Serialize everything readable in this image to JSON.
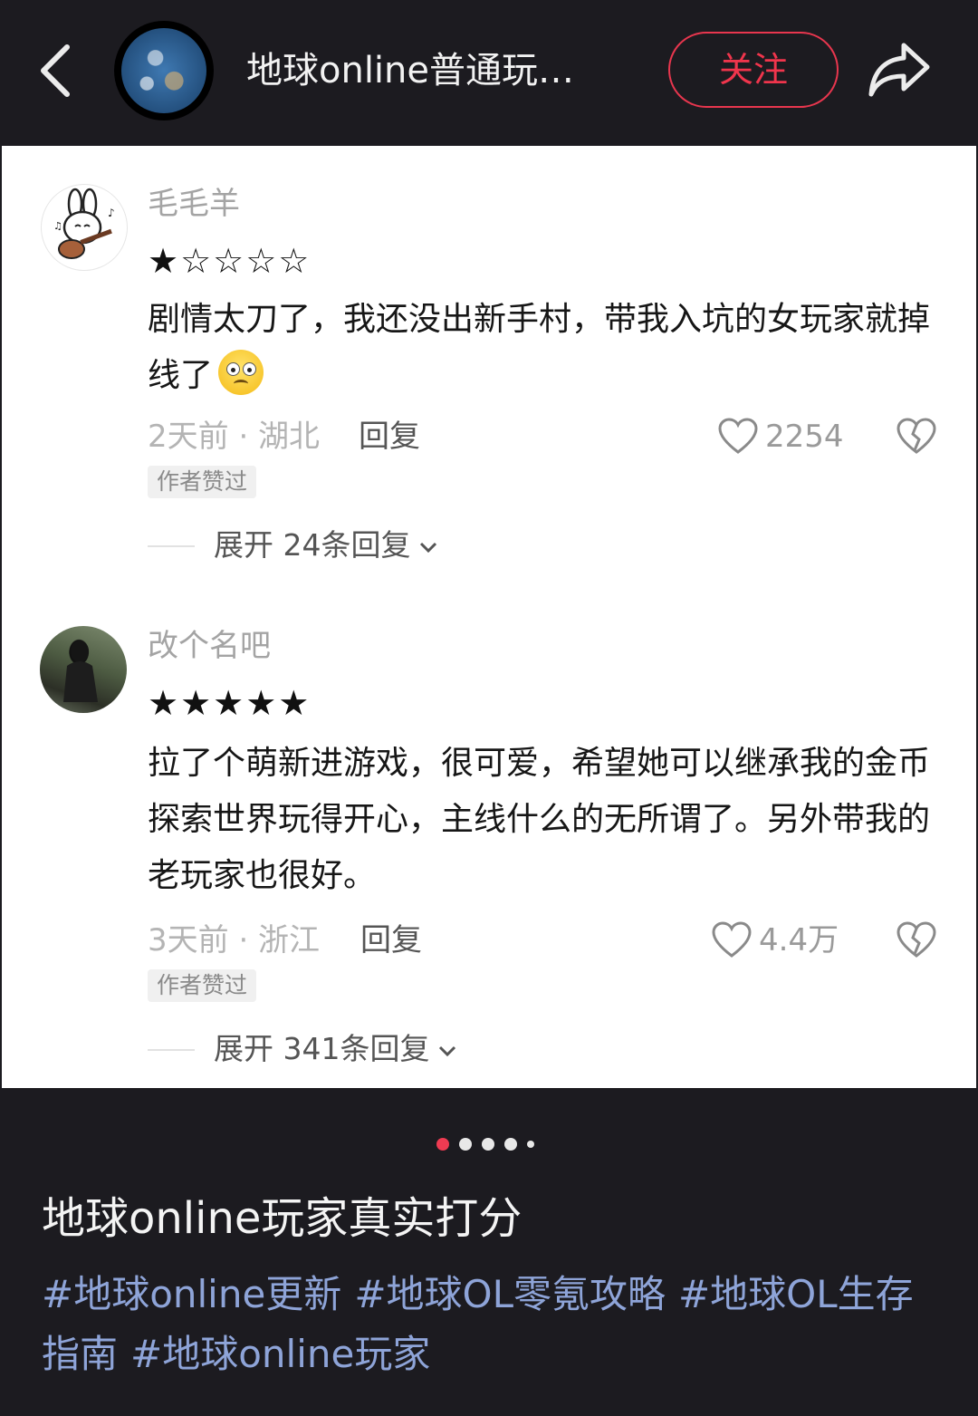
{
  "header": {
    "title": "地球online普通玩…",
    "follow_label": "关注",
    "accent_color": "#f0354c",
    "icons": [
      "back-arrow-icon",
      "earth-avatar",
      "share-icon"
    ]
  },
  "comments": [
    {
      "username": "毛毛羊",
      "stars": "★☆☆☆☆",
      "rating": 1,
      "text": "剧情太刀了，我还没出新手村，带我入坑的女玩家就掉线了",
      "emoji": "eyes-emoji",
      "time_location": "2天前 · 湖北",
      "reply_label": "回复",
      "likes": "2254",
      "badge": "作者赞过",
      "expand_label": "展开 24条回复"
    },
    {
      "username": "改个名吧",
      "stars": "★★★★★",
      "rating": 5,
      "text": "拉了个萌新进游戏，很可爱，希望她可以继承我的金币探索世界玩得开心，主线什么的无所谓了。另外带我的老玩家也很好。",
      "time_location": "3天前 · 浙江",
      "reply_label": "回复",
      "likes": "4.4万",
      "badge": "作者赞过",
      "expand_label": "展开 341条回复"
    }
  ],
  "pager": {
    "count": 5,
    "active": 1
  },
  "post": {
    "title": "地球online玩家真实打分",
    "tags": [
      "#地球online更新",
      "#地球OL零氪攻略",
      "#地球OL生存指南",
      "#地球online玩家"
    ]
  }
}
